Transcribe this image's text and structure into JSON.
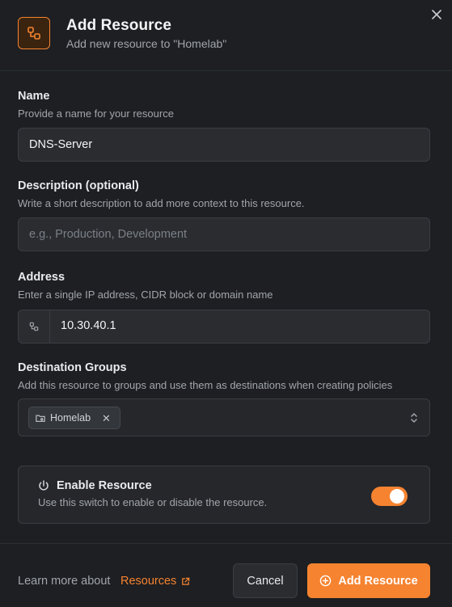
{
  "colors": {
    "accent": "#f68330",
    "background": "#1d1f22",
    "input_bg": "#2a2c30"
  },
  "header": {
    "title": "Add Resource",
    "subtitle": "Add new resource to \"Homelab\"",
    "icon": "resource-icon",
    "close_icon": "close-icon"
  },
  "fields": {
    "name": {
      "label": "Name",
      "help": "Provide a name for your resource",
      "value": "DNS-Server"
    },
    "description": {
      "label": "Description (optional)",
      "help": "Write a short description to add more context to this resource.",
      "placeholder": "e.g., Production, Development",
      "value": ""
    },
    "address": {
      "label": "Address",
      "help": "Enter a single IP address, CIDR block or domain name",
      "value": "10.30.40.1",
      "icon": "resource-icon"
    },
    "groups": {
      "label": "Destination Groups",
      "help": "Add this resource to groups and use them as destinations when creating policies",
      "selected": [
        {
          "label": "Homelab",
          "icon": "folder-network-icon"
        }
      ],
      "chevron_icon": "chevron-up-down-icon"
    }
  },
  "toggle": {
    "title": "Enable Resource",
    "description": "Use this switch to enable or disable the resource.",
    "icon": "power-icon",
    "enabled": true
  },
  "footer": {
    "learn_text": "Learn more about",
    "learn_link": "Resources",
    "learn_link_icon": "external-link-icon",
    "cancel_label": "Cancel",
    "add_label": "Add Resource",
    "add_icon": "plus-circle-icon"
  }
}
